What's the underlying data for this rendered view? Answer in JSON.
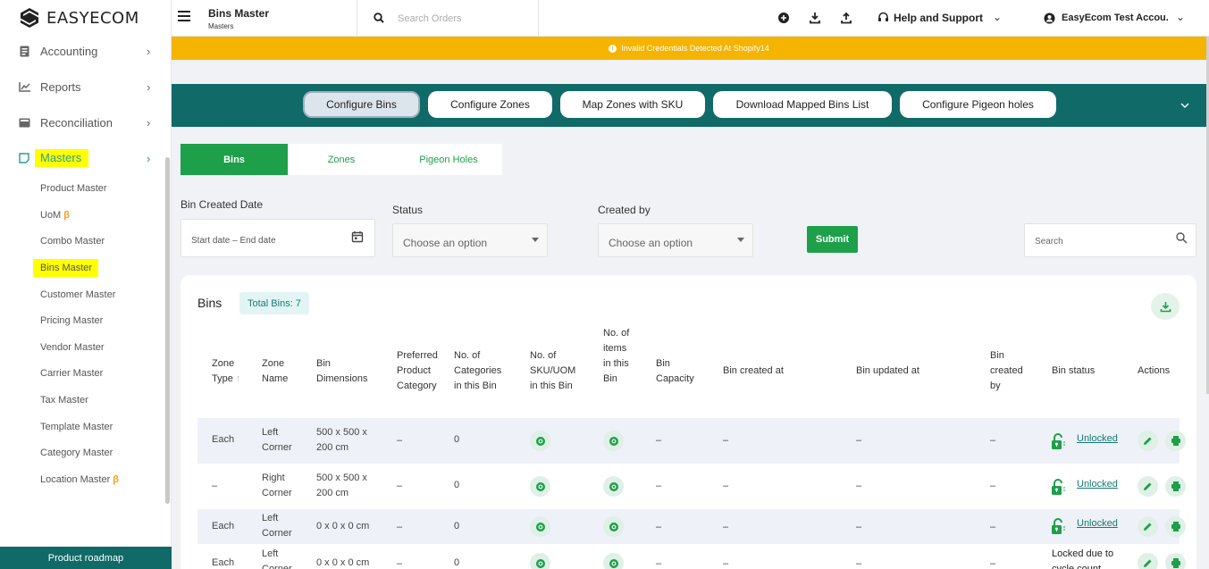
{
  "brand": {
    "name": "EASYECOM"
  },
  "sidebar": {
    "main_items": [
      {
        "label": "Accounting",
        "icon": "accounting-icon"
      },
      {
        "label": "Reports",
        "icon": "reports-icon"
      },
      {
        "label": "Reconciliation",
        "icon": "reconciliation-icon"
      },
      {
        "label": "Masters",
        "icon": "masters-icon"
      }
    ],
    "sub_items": [
      {
        "label": "Product Master"
      },
      {
        "label": "UoM",
        "beta": "β"
      },
      {
        "label": "Combo Master"
      },
      {
        "label": "Bins Master"
      },
      {
        "label": "Customer Master"
      },
      {
        "label": "Pricing Master"
      },
      {
        "label": "Vendor Master"
      },
      {
        "label": "Carrier Master"
      },
      {
        "label": "Tax Master"
      },
      {
        "label": "Template Master"
      },
      {
        "label": "Category Master"
      },
      {
        "label": "Location Master",
        "beta": "β"
      }
    ],
    "roadmap_label": "Product roadmap"
  },
  "header": {
    "title": "Bins Master",
    "breadcrumb": "Masters",
    "search_placeholder": "Search Orders",
    "help_label": "Help and Support",
    "user_name": "EasyEcom Test Accou..."
  },
  "alert": {
    "text": "Invalid Credentials Detected At Shopify14"
  },
  "toolbar": {
    "buttons": [
      {
        "label": "Configure Bins"
      },
      {
        "label": "Configure Zones"
      },
      {
        "label": "Map Zones with SKU"
      },
      {
        "label": "Download Mapped Bins List"
      },
      {
        "label": "Configure Pigeon holes"
      }
    ]
  },
  "subtabs": [
    {
      "label": "Bins"
    },
    {
      "label": "Zones"
    },
    {
      "label": "Pigeon Holes"
    }
  ],
  "filters": {
    "date_label": "Bin Created Date",
    "date_start": "Start date",
    "date_sep": "–",
    "date_end": "End date",
    "status_label": "Status",
    "status_placeholder": "Choose an option",
    "created_by_label": "Created by",
    "created_by_placeholder": "Choose an option",
    "submit_label": "Submit",
    "search_placeholder": "Search"
  },
  "table": {
    "title": "Bins",
    "total_label": "Total Bins: 7",
    "columns": [
      "Zone Type",
      "Zone Name",
      "Bin Dimensions",
      "Preferred Product Category",
      "No. of Categories in this Bin",
      "No. of SKU/UOM in this Bin",
      "No. of items in this Bin",
      "Bin Capacity",
      "Bin created at",
      "Bin updated at",
      "Bin created by",
      "Bin status",
      "Actions"
    ],
    "rows": [
      {
        "zone_type": "Each",
        "zone_name": "Left Corner",
        "dims": "500 x 500 x 200 cm",
        "pref": "–",
        "cats": "0",
        "capacity": "–",
        "created": "–",
        "updated": "–",
        "by": "–",
        "status": "Unlocked"
      },
      {
        "zone_type": "–",
        "zone_name": "Right Corner",
        "dims": "500 x 500 x 200 cm",
        "pref": "–",
        "cats": "0",
        "capacity": "–",
        "created": "–",
        "updated": "–",
        "by": "–",
        "status": "Unlocked"
      },
      {
        "zone_type": "Each",
        "zone_name": "Left Corner",
        "dims": "0 x 0 x 0 cm",
        "pref": "–",
        "cats": "0",
        "capacity": "–",
        "created": "–",
        "updated": "–",
        "by": "–",
        "status": "Unlocked"
      },
      {
        "zone_type": "Each",
        "zone_name": "Left Corner",
        "dims": "0 x 0 x 0 cm",
        "pref": "–",
        "cats": "0",
        "capacity": "–",
        "created": "–",
        "updated": "–",
        "by": "–",
        "status": "Locked due to cycle count"
      }
    ]
  },
  "colors": {
    "accent_teal": "#106a68",
    "green": "#1e9f4a",
    "alert": "#f4b400",
    "highlight": "#ffff00"
  }
}
